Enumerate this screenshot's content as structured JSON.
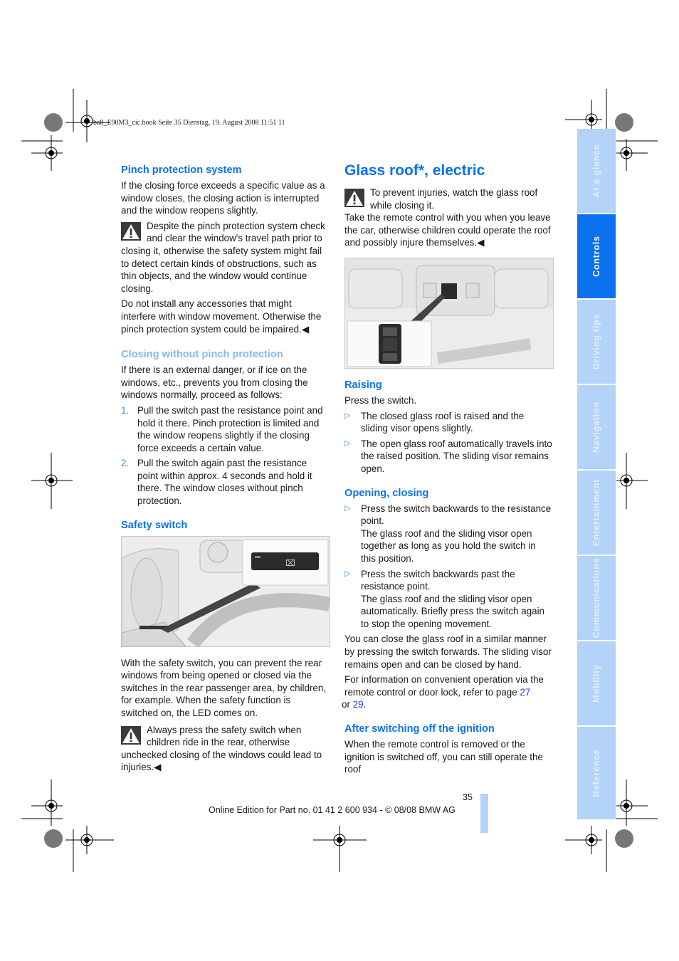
{
  "print_header": "ba8_E90M3_cic.book  Seite 35  Dienstag, 19. August 2008  11:51 11",
  "left_column": {
    "pinch_protection": {
      "heading": "Pinch protection system",
      "intro": "If the closing force exceeds a specific value as a window closes, the closing action is interrupted and the window reopens slightly.",
      "warning": "Despite the pinch protection system check and clear the window's travel path prior to closing it, otherwise the safety system might fail to detect certain kinds of obstructions, such as thin objects, and the window would continue closing.",
      "warning_2": "Do not install any accessories that might interfere with window movement. Otherwise the pinch protection system could be impaired.",
      "end_mark": "◀"
    },
    "closing_without": {
      "heading": "Closing without pinch protection",
      "intro": "If there is an external danger, or if ice on the windows, etc., prevents you from closing the windows normally, proceed as follows:",
      "steps": [
        {
          "num": "1.",
          "text": "Pull the switch past the resistance point and hold it there. Pinch protection is limited and the window reopens slightly if the closing force exceeds a certain value."
        },
        {
          "num": "2.",
          "text": "Pull the switch again past the resistance point within approx. 4 seconds and hold it there. The window closes without pinch protection."
        }
      ]
    },
    "safety_switch": {
      "heading": "Safety switch",
      "body": "With the safety switch, you can prevent the rear windows from being opened or closed via the switches in the rear passenger area, by children, for example. When the safety function is switched on, the LED comes on.",
      "warning": "Always press the safety switch when children ride in the rear, otherwise unchecked closing of the windows could lead to injuries.",
      "end_mark": "◀"
    }
  },
  "right_column": {
    "title": "Glass roof*, electric",
    "warning": "To prevent injuries, watch the glass roof while closing it.",
    "warning_2": "Take the remote control with you when you leave the car, otherwise children could operate the roof and possibly injure themselves.",
    "end_mark": "◀",
    "raising": {
      "heading": "Raising",
      "intro": "Press the switch.",
      "bullets": [
        "The closed glass roof is raised and the sliding visor opens slightly.",
        "The open glass roof automatically travels into the raised position. The sliding visor remains open."
      ]
    },
    "opening_closing": {
      "heading": "Opening, closing",
      "bullets": [
        {
          "text": "Press the switch backwards to the resistance point.",
          "detail": "The glass roof and the sliding visor open together as long as you hold the switch in this position."
        },
        {
          "text": "Press the switch backwards past the resistance point.",
          "detail": "The glass roof and the sliding visor open automatically. Briefly press the switch again to stop the opening movement."
        }
      ],
      "closing_note": "You can close the glass roof in a similar manner by pressing the switch forwards. The sliding visor remains open and can be closed by hand.",
      "info_prefix": "For information on convenient operation via the remote control or door lock, refer to page ",
      "link_1": "27",
      "info_mid": " or ",
      "link_2": "29",
      "info_suffix": "."
    },
    "after_ignition": {
      "heading": "After switching off the ignition",
      "body": "When the remote control is removed or the ignition is switched off, you can still operate the roof"
    }
  },
  "side_tabs": [
    {
      "label": "At a glance",
      "active": false
    },
    {
      "label": "Controls",
      "active": true
    },
    {
      "label": "Driving tips",
      "active": false
    },
    {
      "label": "Navigation",
      "active": false
    },
    {
      "label": "Entertainment",
      "active": false
    },
    {
      "label": "Communications",
      "active": false
    },
    {
      "label": "Mobility",
      "active": false
    },
    {
      "label": "Reference",
      "active": false
    }
  ],
  "footer": {
    "page_number": "35",
    "edition": "Online Edition for Part no. 01 41 2 600 934 - © 08/08 BMW AG"
  },
  "colors": {
    "accent": "#0a72ee",
    "accent_light": "#86b8f3",
    "tab_inactive": "#b3d3f9",
    "link": "#1a3ee8"
  }
}
